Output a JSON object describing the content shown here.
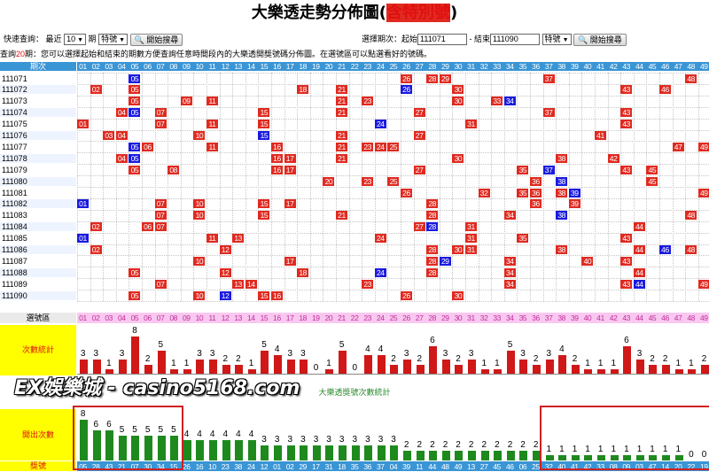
{
  "page": {
    "title_main": "大樂透走勢分佈圖",
    "title_paren_open": "(",
    "title_special": "含特別號",
    "title_paren_close": ")",
    "watermark": "EX娛樂城 - casino5168.com"
  },
  "toolbar": {
    "quick_label": "快速查詢：",
    "recent_label": "最近",
    "recent_value": "10",
    "period_label": "期",
    "special_value": "特號",
    "start_button": "開始搜尋",
    "range_label": "選擇期次：起始",
    "range_start": "111071",
    "range_mid": "- 結束",
    "range_end": "111090",
    "special_value2": "特號",
    "start_button2": "開始搜尋"
  },
  "notice": {
    "prefix": "查詢",
    "count": "20",
    "suffix": "期：您可以選擇起始和結束的期數方便查詢任意時間段內的大樂透開獎號碼分佈圖。在選號區可以點選看好的號碼。"
  },
  "table": {
    "period_header": "期次",
    "numbers": [
      "01",
      "02",
      "03",
      "04",
      "05",
      "06",
      "07",
      "08",
      "09",
      "10",
      "11",
      "12",
      "13",
      "14",
      "15",
      "16",
      "17",
      "18",
      "19",
      "20",
      "21",
      "22",
      "23",
      "24",
      "25",
      "26",
      "27",
      "28",
      "29",
      "30",
      "31",
      "32",
      "33",
      "34",
      "35",
      "36",
      "37",
      "38",
      "39",
      "40",
      "41",
      "42",
      "43",
      "44",
      "45",
      "46",
      "47",
      "48",
      "49"
    ],
    "draws": [
      {
        "period": "111071",
        "nums": [
          5,
          26,
          28,
          29,
          37,
          48
        ],
        "special": 5
      },
      {
        "period": "111072",
        "nums": [
          2,
          5,
          18,
          21,
          26,
          30,
          43,
          46
        ],
        "special": 26
      },
      {
        "period": "111073",
        "nums": [
          5,
          9,
          11,
          21,
          23,
          30,
          33,
          34
        ],
        "special": 34
      },
      {
        "period": "111074",
        "nums": [
          4,
          5,
          7,
          15,
          21,
          27,
          37,
          43
        ],
        "special": 5
      },
      {
        "period": "111075",
        "nums": [
          1,
          7,
          11,
          15,
          24,
          31,
          43
        ],
        "special": 24
      },
      {
        "period": "111076",
        "nums": [
          3,
          4,
          10,
          15,
          21,
          27,
          41
        ],
        "special": 15
      },
      {
        "period": "111077",
        "nums": [
          5,
          6,
          11,
          16,
          21,
          23,
          24,
          25,
          47,
          49
        ],
        "special": 5
      },
      {
        "period": "111078",
        "nums": [
          4,
          5,
          16,
          17,
          21,
          30,
          38,
          42
        ],
        "special": 5
      },
      {
        "period": "111079",
        "nums": [
          5,
          8,
          16,
          17,
          27,
          35,
          37,
          43,
          45
        ],
        "special": 37
      },
      {
        "period": "111080",
        "nums": [
          20,
          23,
          25,
          36,
          38,
          45
        ],
        "special": 38
      },
      {
        "period": "111081",
        "nums": [
          26,
          32,
          35,
          36,
          38,
          39,
          49
        ],
        "special": 39
      },
      {
        "period": "111082",
        "nums": [
          1,
          7,
          10,
          15,
          17,
          28,
          36,
          39
        ],
        "special": 1
      },
      {
        "period": "111083",
        "nums": [
          7,
          10,
          15,
          21,
          28,
          34,
          38,
          48
        ],
        "special": 38
      },
      {
        "period": "111084",
        "nums": [
          2,
          6,
          7,
          27,
          28,
          31,
          44
        ],
        "special": 28
      },
      {
        "period": "111085",
        "nums": [
          1,
          11,
          13,
          24,
          31,
          35,
          43
        ],
        "special": 1
      },
      {
        "period": "111086",
        "nums": [
          2,
          12,
          28,
          30,
          31,
          38,
          44,
          46,
          48
        ],
        "special": 46
      },
      {
        "period": "111087",
        "nums": [
          10,
          17,
          28,
          29,
          34,
          40,
          43
        ],
        "special": 29
      },
      {
        "period": "111088",
        "nums": [
          5,
          12,
          18,
          24,
          28,
          34,
          44
        ],
        "special": 24
      },
      {
        "period": "111089",
        "nums": [
          7,
          13,
          14,
          23,
          34,
          43,
          44,
          49
        ],
        "special": 44
      },
      {
        "period": "111090",
        "nums": [
          5,
          10,
          12,
          15,
          16,
          26,
          30
        ],
        "special": 12
      }
    ],
    "select_label": "選號區",
    "freq_label": "次數統計",
    "freq_values": [
      3,
      3,
      1,
      3,
      8,
      2,
      5,
      1,
      1,
      3,
      3,
      2,
      2,
      1,
      5,
      4,
      3,
      3,
      0,
      1,
      5,
      0,
      4,
      4,
      2,
      3,
      2,
      6,
      3,
      2,
      3,
      1,
      1,
      5,
      3,
      2,
      3,
      4,
      2,
      1,
      1,
      1,
      6,
      3,
      2,
      2,
      1,
      1,
      2
    ],
    "rank_title": "大樂透獎號次數統計",
    "rank_freq_label": "開出次數",
    "rank_number_label": "獎號",
    "rank_numbers": [
      "05",
      "28",
      "43",
      "21",
      "07",
      "30",
      "34",
      "15",
      "26",
      "16",
      "10",
      "23",
      "38",
      "24",
      "12",
      "01",
      "02",
      "29",
      "17",
      "31",
      "18",
      "35",
      "36",
      "37",
      "04",
      "39",
      "11",
      "44",
      "48",
      "49",
      "13",
      "27",
      "45",
      "46",
      "06",
      "25",
      "32",
      "40",
      "41",
      "42",
      "33",
      "08",
      "09",
      "03",
      "47",
      "14",
      "20",
      "22",
      "19"
    ],
    "rank_values": [
      8,
      6,
      6,
      5,
      5,
      5,
      5,
      5,
      4,
      4,
      4,
      4,
      4,
      4,
      3,
      3,
      3,
      3,
      3,
      3,
      3,
      3,
      3,
      3,
      3,
      2,
      2,
      2,
      2,
      2,
      2,
      2,
      2,
      2,
      2,
      2,
      1,
      1,
      1,
      1,
      1,
      1,
      1,
      1,
      1,
      1,
      1,
      0,
      0
    ]
  },
  "colors": {
    "red": "#e02a20",
    "blue": "#1a1ae0",
    "header": "#3a95d5",
    "select_bg": "#f9c8f0",
    "freq_bg": "#ffff00",
    "green": "#1e8a1e"
  }
}
